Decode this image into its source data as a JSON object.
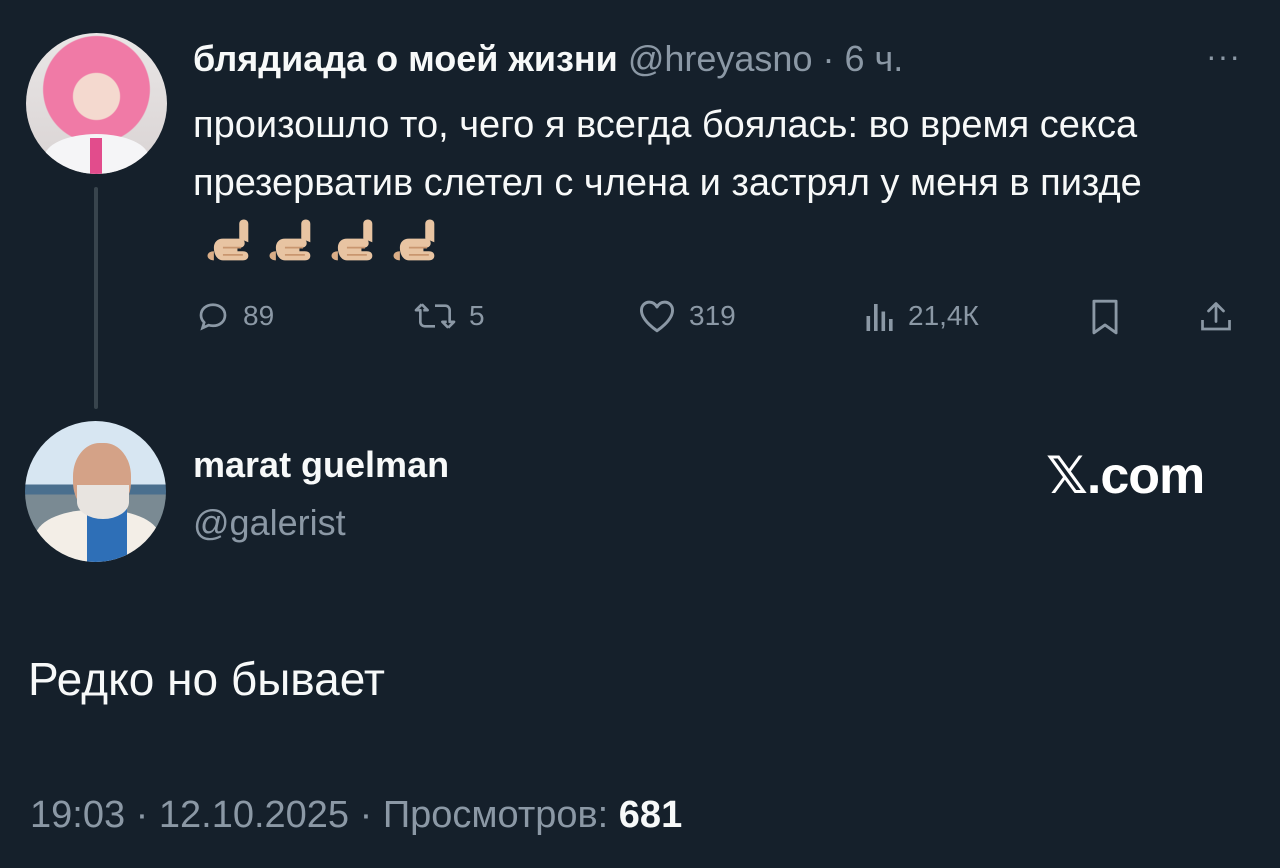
{
  "tweet": {
    "author_name": "блядиада о моей жизни",
    "handle": "@hreyasno",
    "separator": " · ",
    "time": "6 ч.",
    "more_label": "···",
    "text": "произошло то, чего я всегда боялась: во время секса презерватив слетел с члена и застрял у меня в пизде",
    "emoji_count": 4,
    "stats": {
      "replies": "89",
      "retweets": "5",
      "likes": "319",
      "views": "21,4К"
    }
  },
  "reply_tweet": {
    "author_name": "marat guelman",
    "handle": "@galerist",
    "watermark": "𝕏.com",
    "text": "Редко но бывает",
    "timestamp": "19:03 · 12.10.2025 · Просмотров: ",
    "views": "681"
  },
  "colors": {
    "background": "#15202b",
    "text": "#f7f9f9",
    "secondary": "#8b98a5",
    "thread_line": "#38444d"
  },
  "icons": [
    "reply-icon",
    "retweet-icon",
    "like-icon",
    "views-icon",
    "bookmark-icon",
    "share-icon",
    "more-icon",
    "call-me-hand-emoji"
  ]
}
